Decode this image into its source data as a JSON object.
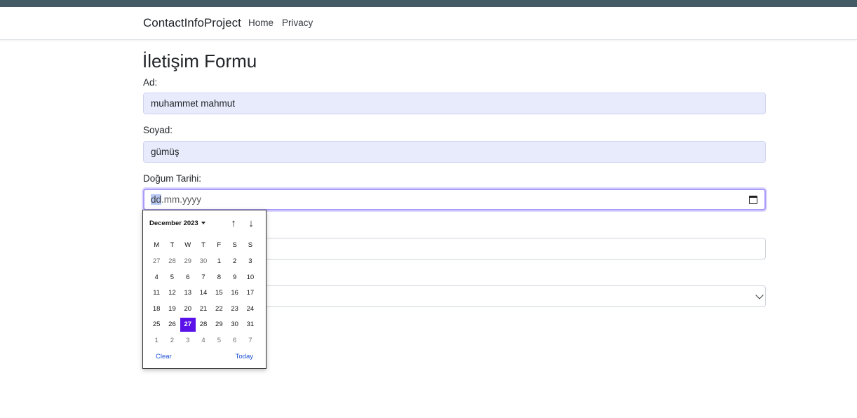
{
  "navbar": {
    "brand": "ContactInfoProject",
    "links": [
      "Home",
      "Privacy"
    ]
  },
  "form": {
    "title": "İletişim Formu",
    "first_name": {
      "label": "Ad:",
      "value": "muhammet mahmut"
    },
    "last_name": {
      "label": "Soyad:",
      "value": "gümüş"
    },
    "birth_date": {
      "label": "Doğum Tarihi:",
      "placeholder_day": "dd",
      "placeholder_rest": ".mm.yyyy"
    }
  },
  "calendar": {
    "month_year": "December 2023",
    "weekdays": [
      "M",
      "T",
      "W",
      "T",
      "F",
      "S",
      "S"
    ],
    "weeks": [
      [
        "27",
        "28",
        "29",
        "30",
        "1",
        "2",
        "3"
      ],
      [
        "4",
        "5",
        "6",
        "7",
        "8",
        "9",
        "10"
      ],
      [
        "11",
        "12",
        "13",
        "14",
        "15",
        "16",
        "17"
      ],
      [
        "18",
        "19",
        "20",
        "21",
        "22",
        "23",
        "24"
      ],
      [
        "25",
        "26",
        "27",
        "28",
        "29",
        "30",
        "31"
      ],
      [
        "1",
        "2",
        "3",
        "4",
        "5",
        "6",
        "7"
      ]
    ],
    "muted_cells": {
      "0": [
        0,
        1,
        2,
        3
      ],
      "5": [
        0,
        1,
        2,
        3,
        4,
        5,
        6
      ]
    },
    "selected_day": "27",
    "clear_label": "Clear",
    "today_label": "Today"
  },
  "icons": {
    "calendar": "calendar-icon",
    "prev_month": "arrow-up-icon",
    "next_month": "arrow-down-icon",
    "month_menu": "caret-down-icon",
    "select": "chevron-down-icon"
  },
  "colors": {
    "topstrip": "#445a65",
    "autofill_bg": "#e8ebfb",
    "selected_day": "#5a12e8",
    "link": "#1a4fd6"
  }
}
